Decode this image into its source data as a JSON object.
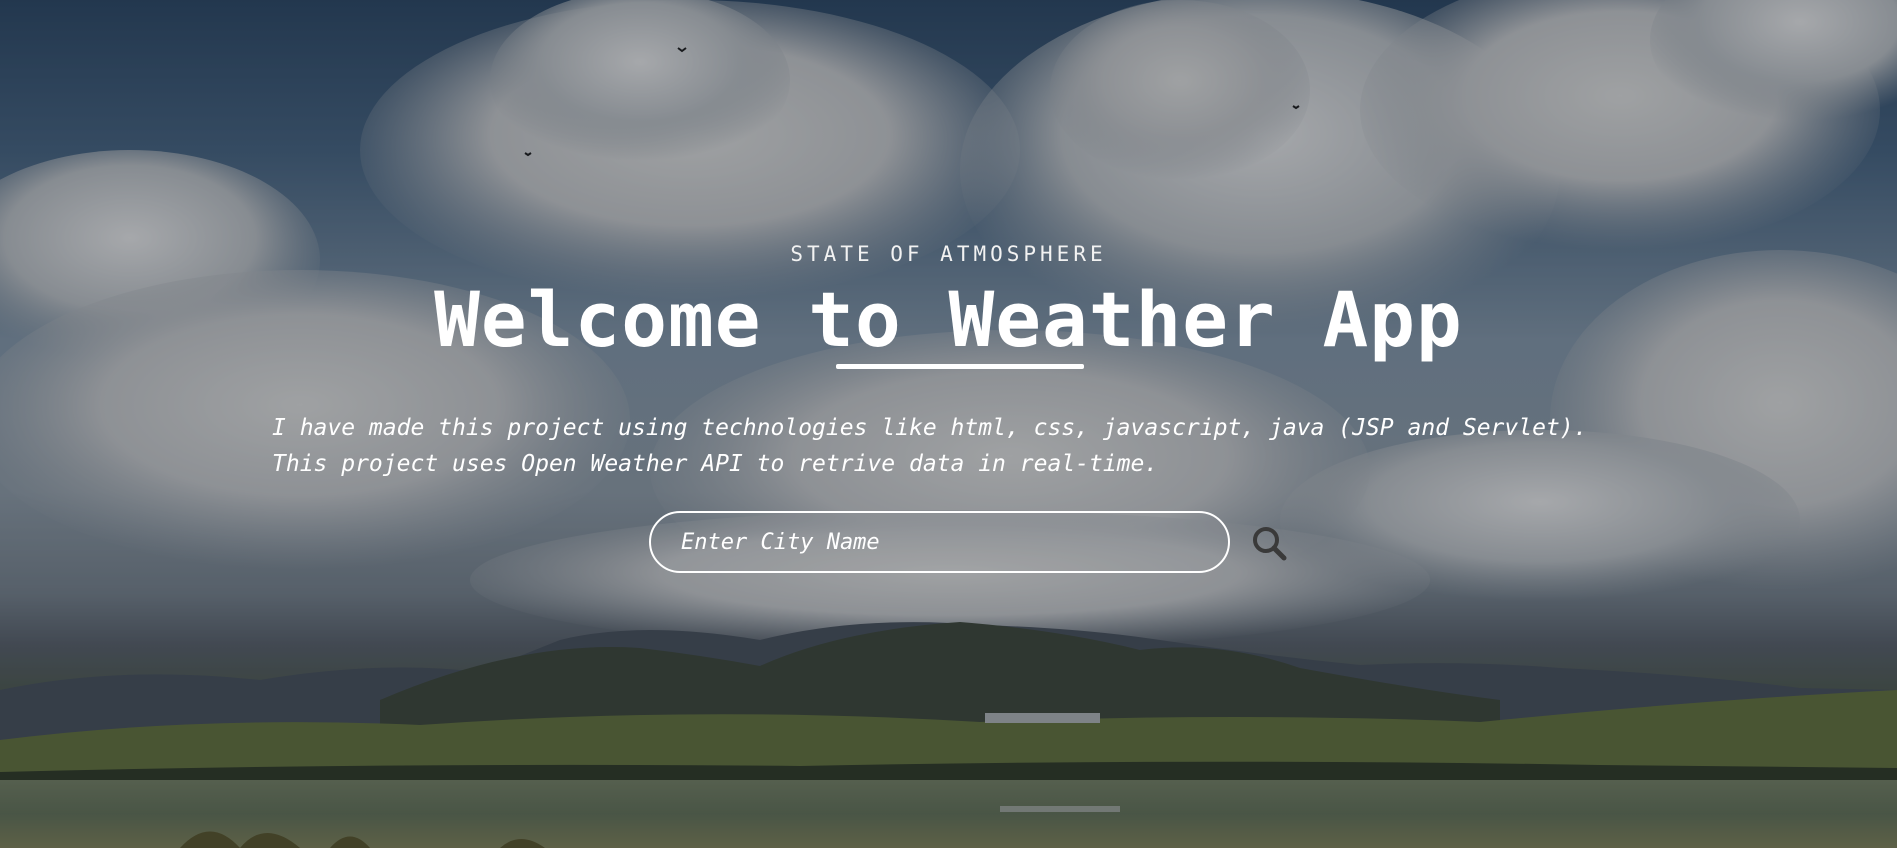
{
  "hero": {
    "eyebrow": "STATE OF ATMOSPHERE",
    "title": "Welcome to Weather App",
    "description_lines": [
      "I have made this project using technologies like html, css, javascript, java (JSP and Servlet).",
      "This project uses Open Weather API to retrive data in real-time."
    ]
  },
  "search": {
    "placeholder": "Enter City Name",
    "value": "",
    "icon": "search-icon"
  },
  "colors": {
    "text": "#ffffff",
    "overlay": "#141923",
    "search_icon": "#3a3a3a"
  }
}
